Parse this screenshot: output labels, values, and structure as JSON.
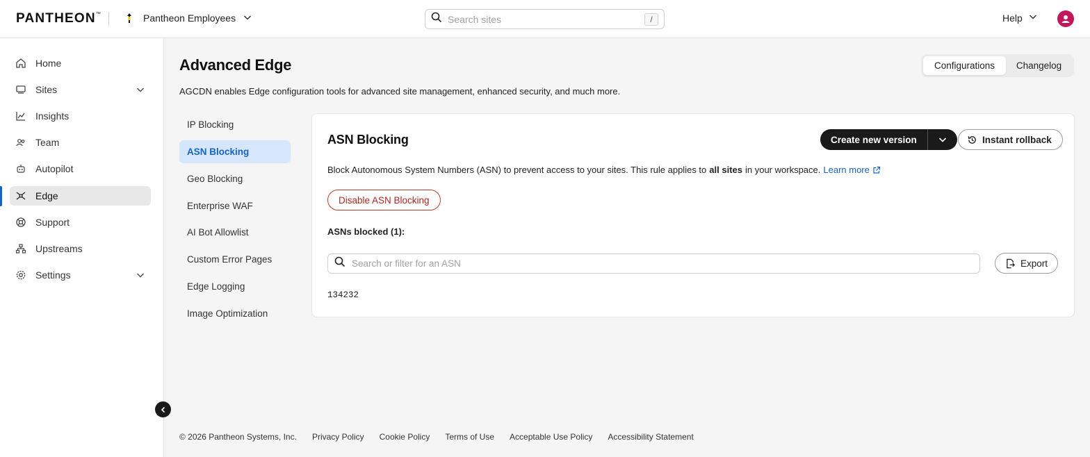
{
  "header": {
    "logo": "PANTHEON",
    "logo_tm": "™",
    "org_name": "Pantheon Employees",
    "search_placeholder": "Search sites",
    "search_shortcut": "/",
    "help_label": "Help"
  },
  "sidebar": {
    "items": [
      {
        "label": "Home",
        "icon": "home-icon"
      },
      {
        "label": "Sites",
        "icon": "sites-icon",
        "expandable": true
      },
      {
        "label": "Insights",
        "icon": "insights-icon"
      },
      {
        "label": "Team",
        "icon": "team-icon"
      },
      {
        "label": "Autopilot",
        "icon": "autopilot-icon"
      },
      {
        "label": "Edge",
        "icon": "edge-icon",
        "active": true
      },
      {
        "label": "Support",
        "icon": "support-icon"
      },
      {
        "label": "Upstreams",
        "icon": "upstreams-icon"
      },
      {
        "label": "Settings",
        "icon": "settings-icon",
        "expandable": true
      }
    ]
  },
  "page": {
    "title": "Advanced Edge",
    "description": "AGCDN enables Edge configuration tools for advanced site management, enhanced security, and much more.",
    "tabs": [
      {
        "label": "Configurations",
        "active": true
      },
      {
        "label": "Changelog",
        "active": false
      }
    ]
  },
  "subnav": {
    "items": [
      {
        "label": "IP Blocking"
      },
      {
        "label": "ASN Blocking",
        "active": true
      },
      {
        "label": "Geo Blocking"
      },
      {
        "label": "Enterprise WAF"
      },
      {
        "label": "AI Bot Allowlist"
      },
      {
        "label": "Custom Error Pages"
      },
      {
        "label": "Edge Logging"
      },
      {
        "label": "Image Optimization"
      }
    ]
  },
  "card": {
    "title": "ASN Blocking",
    "create_version_label": "Create new version",
    "rollback_label": "Instant rollback",
    "desc_before": "Block Autonomous System Numbers (ASN) to prevent access to your sites. This rule applies to",
    "desc_bold": "all sites",
    "desc_after": "in your workspace.",
    "learn_more": "Learn more",
    "disable_label": "Disable ASN Blocking",
    "blocked_label": "ASNs blocked (1):",
    "filter_placeholder": "Search or filter for an ASN",
    "export_label": "Export",
    "asns": [
      "134232"
    ]
  },
  "footer": {
    "copyright": "© 2026 Pantheon Systems, Inc.",
    "links": [
      "Privacy Policy",
      "Cookie Policy",
      "Terms of Use",
      "Acceptable Use Policy",
      "Accessibility Statement"
    ]
  },
  "colors": {
    "accent": "#1565c0",
    "active_subnav_bg": "#d6e6fb",
    "danger": "#b3261e",
    "primary_button": "#1a1a1a",
    "avatar": "#c2185b"
  }
}
